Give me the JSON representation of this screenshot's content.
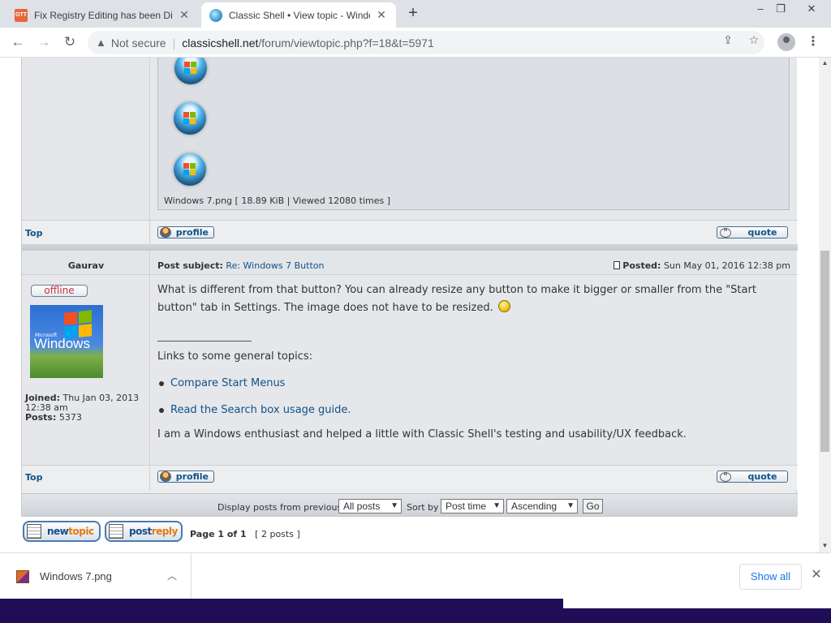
{
  "browser": {
    "tabs": [
      {
        "title": "Fix Registry Editing has been Dis",
        "favicon_text": "OTT"
      },
      {
        "title": "Classic Shell • View topic - Windo"
      }
    ],
    "new_tab_icon": "plus-icon",
    "window_controls": {
      "minimize": "–",
      "restore": "❐",
      "close": "✕"
    },
    "security_label": "Not secure",
    "url_domain": "classicshell.net",
    "url_path": "/forum/viewtopic.php?f=18&t=5971"
  },
  "attachment": {
    "caption": "Windows 7.png [ 18.89 KiB | Viewed 12080 times ]"
  },
  "post1_footer": {
    "top_label": "Top",
    "profile_label": "profile",
    "quote_label": "quote"
  },
  "post2": {
    "author": "Gaurav",
    "subject_label": "Post subject:",
    "subject": "Re: Windows 7 Button",
    "posted_label": "Posted:",
    "posted_date": "Sun May 01, 2016 12:38 pm",
    "status": "offline",
    "avatar_brand": "Microsoft",
    "avatar_text": "Windows",
    "joined_label": "Joined:",
    "joined_value": "Thu Jan 03, 2013 12:38 am",
    "posts_label": "Posts:",
    "posts_value": "5373",
    "body_text": "What is different from that button? You can already resize any button to make it bigger or smaller from the \"Start button\" tab in Settings. The image does not have to be resized.",
    "signature_heading": "Links to some general topics:",
    "links": [
      "Compare Start Menus",
      "Read the Search box usage guide."
    ],
    "signature_footer": "I am a Windows enthusiast and helped a little with Classic Shell's testing and usability/UX feedback."
  },
  "post2_footer": {
    "top_label": "Top",
    "profile_label": "profile",
    "quote_label": "quote"
  },
  "display_options": {
    "display_label": "Display posts from previous:",
    "display_value": "All posts",
    "sort_label": "Sort by",
    "sort_value": "Post time",
    "order_value": "Ascending",
    "go_label": "Go"
  },
  "actions": {
    "new_topic": [
      "new",
      "topic"
    ],
    "post_reply": [
      "post",
      "reply"
    ],
    "page_info": "Page 1 of 1",
    "post_count": "[ 2 posts ]"
  },
  "downloads": {
    "file_name": "Windows 7.png",
    "show_all": "Show all"
  },
  "colors": {
    "link": "#105289",
    "offline": "#c8343a",
    "taskbar": "#1f0e57"
  }
}
